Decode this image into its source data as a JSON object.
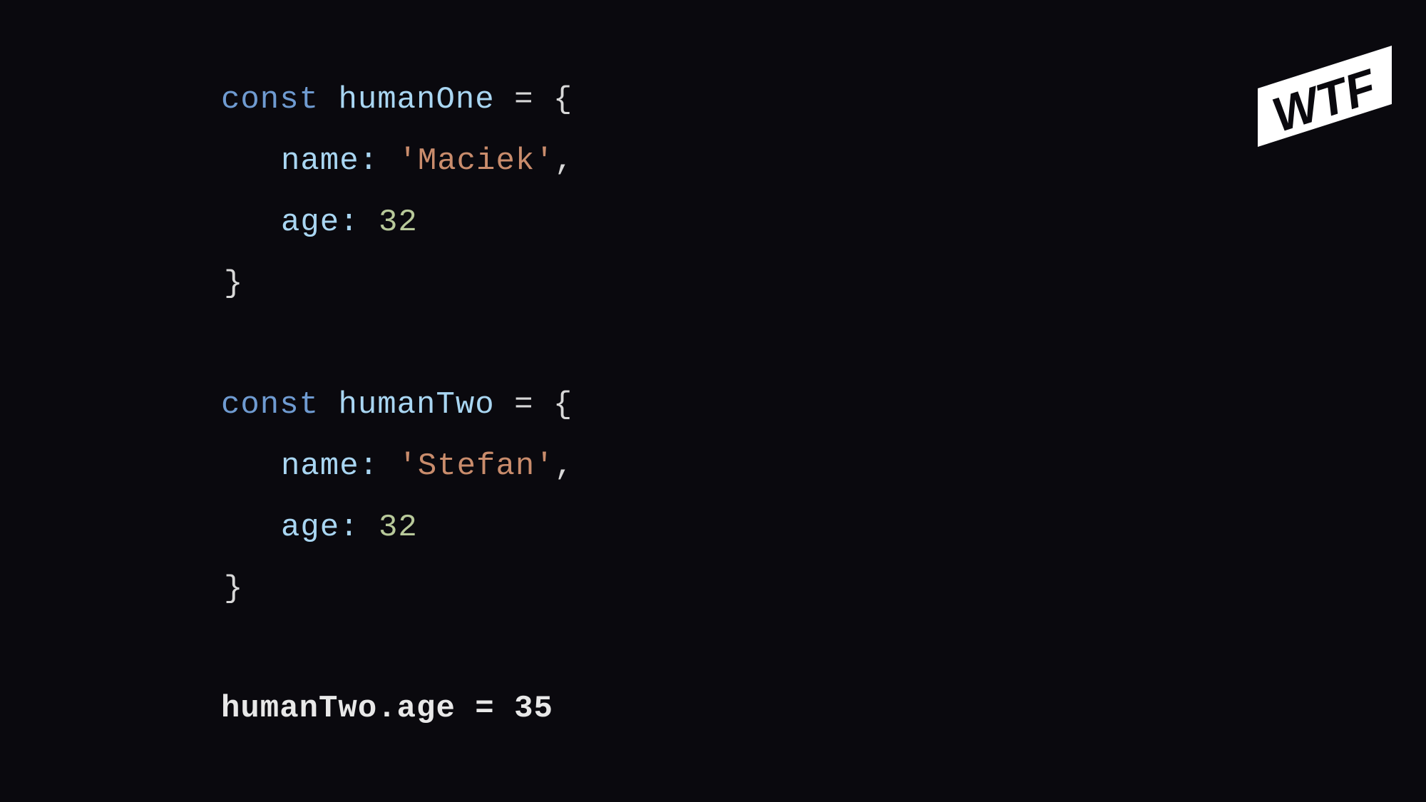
{
  "slide": {
    "logo_text": "WTF",
    "colors": {
      "background": "#0a090e",
      "keyword": "#6f9bd1",
      "identifier": "#a9d6f2",
      "string": "#c98c6c",
      "number": "#b8c99a",
      "punctuation": "#d8d8d8"
    }
  },
  "code": {
    "block1": {
      "kw": "const",
      "var": "humanOne",
      "assign": " = {",
      "name_key": "name:",
      "name_val": "'Maciek'",
      "name_comma": ",",
      "age_key": "age:",
      "age_val": "32",
      "close": "}"
    },
    "block2": {
      "kw": "const",
      "var": "humanTwo",
      "assign": " = {",
      "name_key": "name:",
      "name_val": "'Stefan'",
      "name_comma": ",",
      "age_key": "age:",
      "age_val": "32",
      "close": "}"
    },
    "statement": "humanTwo.age = 35"
  }
}
